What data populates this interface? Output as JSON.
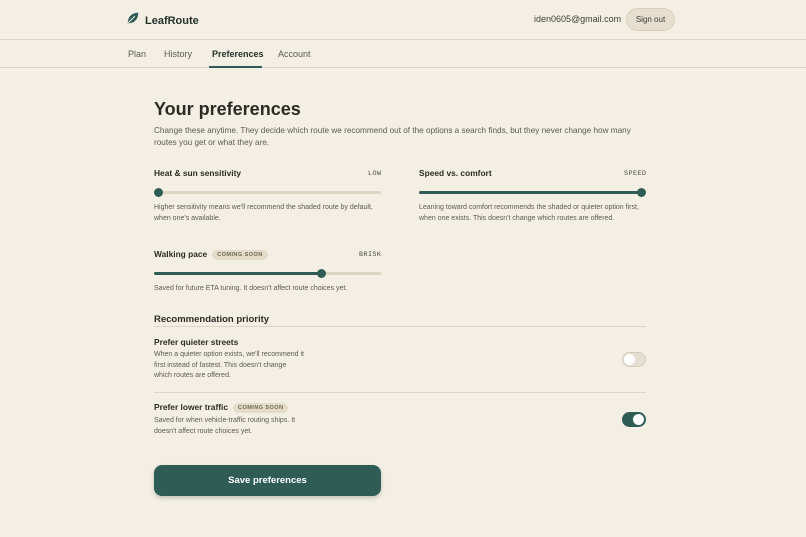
{
  "app": {
    "name": "LeafRoute"
  },
  "user": {
    "email": "iden0605@gmail.com"
  },
  "header": {
    "signout_label": "Sign out"
  },
  "nav": {
    "tabs": [
      {
        "label": "Plan"
      },
      {
        "label": "History"
      },
      {
        "label": "Preferences"
      },
      {
        "label": "Account"
      }
    ],
    "active": "Preferences"
  },
  "page": {
    "title": "Your preferences",
    "intro": "Change these anytime. They decide which route we recommend out of the options a search finds, but they never change how many routes you get or what they are."
  },
  "sliders": {
    "heat": {
      "label": "Heat & sun sensitivity",
      "value_label": "LOW",
      "level": 0.0,
      "help": "Higher sensitivity means we'll recommend the shaded route by default, when one's available."
    },
    "speed": {
      "label": "Speed vs. comfort",
      "value_label": "SPEED",
      "level": 1.0,
      "help": "Leaning toward comfort recommends the shaded or quieter option first, when one exists. This doesn't change which routes are offered."
    },
    "pace": {
      "label": "Walking pace",
      "badge": "COMING SOON",
      "value_label": "BRISK",
      "level": 0.74,
      "help": "Saved for future ETA tuning. It doesn't affect route choices yet."
    }
  },
  "priority": {
    "title": "Recommendation priority",
    "quieter": {
      "label": "Prefer quieter streets",
      "description": "When a quieter option exists, we'll recommend it first instead of fastest. This doesn't change which routes are offered.",
      "enabled": false
    },
    "traffic": {
      "label": "Prefer lower traffic",
      "badge": "COMING SOON",
      "description": "Saved for when vehicle-traffic routing ships. It doesn't affect route choices yet.",
      "enabled": true
    }
  },
  "save_label": "Save preferences",
  "colors": {
    "accent": "#2f5d55",
    "background": "#f4efe4"
  }
}
